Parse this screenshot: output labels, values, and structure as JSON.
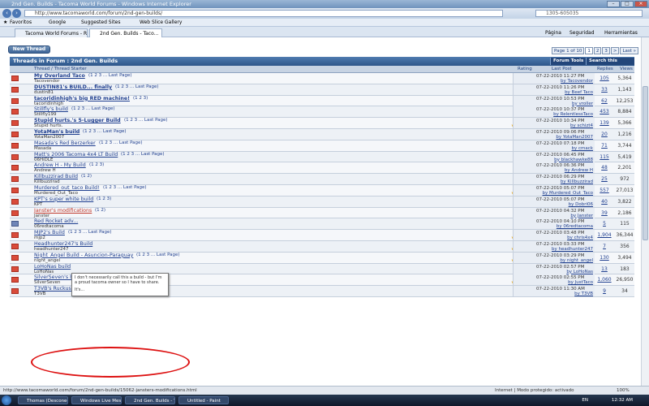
{
  "window": {
    "title": "2nd Gen. Builds - Tacoma World Forums - Windows Internet Explorer"
  },
  "address": {
    "url": "http://www.tacomaworld.com/forum/2nd-gen-builds/",
    "search": "1305-605035"
  },
  "favorites": {
    "label": "Favoritos",
    "items": [
      "Google",
      "Suggested Sites",
      "Web Slice Gallery"
    ]
  },
  "tabs": [
    {
      "label": "Tacoma World Forums - R..."
    },
    {
      "label": "2nd Gen. Builds - Taco..."
    }
  ],
  "commands": [
    "Página",
    "Seguridad",
    "Herramientas"
  ],
  "forum": {
    "new_thread": "New Thread",
    "header": "Threads in Forum : 2nd Gen. Builds",
    "forum_tools": "Forum Tools",
    "search_forum": "Search this Forum",
    "pager": [
      "Page 1 of 10",
      "1",
      "2",
      "3",
      ">",
      "Last »"
    ],
    "columns": {
      "thread": "Thread / Thread Starter",
      "rating": "Rating",
      "last_post": "Last Post",
      "replies": "Replies",
      "views": "Views"
    }
  },
  "threads": [
    {
      "title": "My Overland Taco",
      "pages": "(1 2 3 ... Last Page)",
      "starter": "Tacovendor",
      "date": "07-22-2010 11:27 PM",
      "by": "by Tacovendor",
      "replies": "105",
      "views": "5,364",
      "bold": true,
      "stars": ""
    },
    {
      "title": "DUSTIN81's BUILD... finally",
      "pages": "(1 2 3 ... Last Page)",
      "starter": "dustin81",
      "date": "07-22-2010 11:26 PM",
      "by": "by Beef Taco",
      "replies": "33",
      "views": "1,143",
      "bold": true,
      "stars": ""
    },
    {
      "title": "tacoridinhigh's big RED machine!",
      "pages": "(1 2 3)",
      "starter": "tacoridinhigh",
      "date": "07-22-2010 10:53 PM",
      "by": "by vroller",
      "replies": "62",
      "views": "12,253",
      "bold": true,
      "stars": ""
    },
    {
      "title": "Stillfly's build",
      "pages": "(1 2 3 ... Last Page)",
      "starter": "Stillfly199",
      "date": "07-22-2010 10:37 PM",
      "by": "by RelentlessTaco",
      "replies": "453",
      "views": "8,884",
      "bold": false,
      "stars": ""
    },
    {
      "title": "Stupid hurts.'s 5-Lugger Build",
      "pages": "(1 2 3 ... Last Page)",
      "starter": "Stupid hurts.",
      "date": "07-22-2010 10:34 PM",
      "by": "by schizt4",
      "replies": "139",
      "views": "5,366",
      "bold": true,
      "stars": "★★★★★"
    },
    {
      "title": "YotaMan's build",
      "pages": "(1 2 3 ... Last Page)",
      "starter": "YotaMan2007",
      "date": "07-22-2010 09:06 PM",
      "by": "by YotaMan2007",
      "replies": "20",
      "views": "1,216",
      "bold": true,
      "stars": ""
    },
    {
      "title": "Masada's Red Berzerker",
      "pages": "(1 2 3 ... Last Page)",
      "starter": "Masada",
      "date": "07-22-2010 07:18 PM",
      "by": "by cmack",
      "replies": "71",
      "views": "3,744",
      "bold": false,
      "stars": ""
    },
    {
      "title": "Matt's 2006 Tacoma 4x4 LT Build",
      "pages": "(1 2 3 ... Last Page)",
      "starter": "06HiDLE",
      "date": "07-22-2010 06:45 PM",
      "by": "by blackhawke88",
      "replies": "115",
      "views": "5,419",
      "bold": false,
      "stars": ""
    },
    {
      "title": "Andrew H - My Build",
      "pages": "(1 2 3)",
      "starter": "Andrew H",
      "date": "07-22-2010 06:36 PM",
      "by": "by Andrew H",
      "replies": "48",
      "views": "2,201",
      "bold": false,
      "stars": ""
    },
    {
      "title": "Killbuzzirad Build",
      "pages": "(1 2)",
      "starter": "Killbuzzirad",
      "date": "07-22-2010 06:29 PM",
      "by": "by Killbuzzirad",
      "replies": "25",
      "views": "972",
      "bold": false,
      "stars": ""
    },
    {
      "title": "Murdered_out_taco Build!",
      "pages": "(1 2 3 ... Last Page)",
      "starter": "Murdered_Out_Taco",
      "date": "07-22-2010 05:07 PM",
      "by": "by Murdered_Out_Taco",
      "replies": "557",
      "views": "27,013",
      "bold": false,
      "stars": "★★★★★"
    },
    {
      "title": "KPT's super white build",
      "pages": "(1 2 3)",
      "starter": "KPT",
      "date": "07-22-2010 05:07 PM",
      "by": "by Dobri06",
      "replies": "40",
      "views": "3,822",
      "bold": false,
      "stars": ""
    },
    {
      "title": "Janster's modifications",
      "pages": "(1 2)",
      "starter": "Janster",
      "date": "07-22-2010 04:32 PM",
      "by": "by Janster",
      "replies": "39",
      "views": "2,186",
      "bold": false,
      "red": true,
      "stars": ""
    },
    {
      "title": "Red Rocket adv...",
      "pages": "",
      "starter": "06redtacoma",
      "date": "07-22-2010 04:10 PM",
      "by": "by 06redtacoma",
      "replies": "5",
      "views": "115",
      "bold": false,
      "stars": ""
    },
    {
      "title": "MJP2's Build",
      "pages": "(1 2 3 ... Last Page)",
      "starter": "mjp2",
      "date": "07-22-2010 03:48 PM",
      "by": "by chris4x4",
      "replies": "1,904",
      "views": "36,344",
      "bold": false,
      "stars": "★★★★★"
    },
    {
      "title": "Headhunter247's Build",
      "pages": "",
      "starter": "headhunter247",
      "date": "07-22-2010 03:33 PM",
      "by": "by headhunter247",
      "replies": "7",
      "views": "356",
      "bold": false,
      "stars": "★★★★★"
    },
    {
      "title": "Night_Angel Build - Asuncion-Paraguay",
      "pages": "(1 2 3 ... Last Page)",
      "starter": "night_angel",
      "date": "07-22-2010 03:29 PM",
      "by": "by night_angel",
      "replies": "130",
      "views": "3,494",
      "bold": false,
      "stars": "★★★★★"
    },
    {
      "title": "LoHoNas build",
      "pages": "",
      "starter": "LoHoNas",
      "date": "07-22-2010 02:57 PM",
      "by": "by LoHoNas",
      "replies": "13",
      "views": "183",
      "bold": false,
      "stars": ""
    },
    {
      "title": "SilverSeven's build up",
      "pages": "(1 2 3 ... Last Page)",
      "starter": "SilverSeven",
      "date": "07-22-2010 02:55 PM",
      "by": "by JustTaco",
      "replies": "1,060",
      "views": "26,950",
      "bold": false,
      "stars": "★★★★★"
    },
    {
      "title": "T3VB's Ruckus Carrier",
      "pages": "",
      "starter": "T3VB",
      "date": "07-22-2010 11:30 AM",
      "by": "by T3VB",
      "replies": "9",
      "views": "34",
      "bold": false,
      "stars": ""
    }
  ],
  "tooltip": {
    "text": "I don't necessarily call this a build - but I'm a proud tacoma owner so I have to share.",
    "more": "It's..."
  },
  "status": {
    "url": "http://www.tacomaworld.com/forum/2nd-gen-builds/15062-jansters-modifications.html",
    "zone": "Internet | Modo protegido: activado",
    "zoom": "100%"
  },
  "taskbar": {
    "items": [
      "Thomas (Desconecta...",
      "Windows Live Messe...",
      "2nd Gen. Builds - Ta...",
      "Untitled - Paint"
    ],
    "lang": "EN",
    "time": "12:32 AM"
  }
}
